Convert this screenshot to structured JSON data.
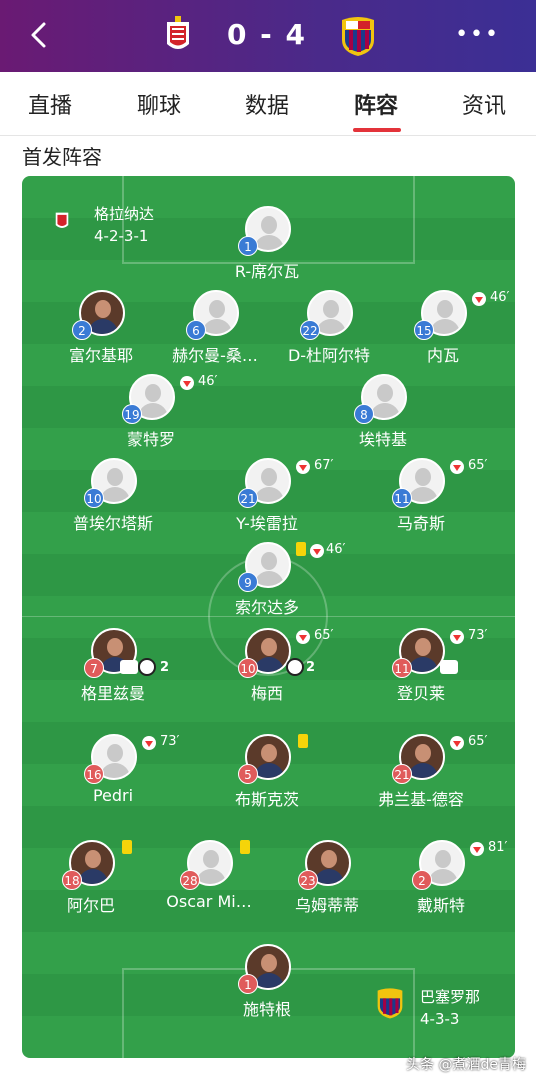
{
  "header": {
    "home_team_icon": "granada-crest-icon",
    "away_team_icon": "barcelona-crest-icon",
    "score": "0 - 4",
    "more_label": "•••"
  },
  "tabs": [
    {
      "label": "直播"
    },
    {
      "label": "聊球"
    },
    {
      "label": "数据"
    },
    {
      "label": "阵容",
      "active": true
    },
    {
      "label": "资讯"
    }
  ],
  "section_title": "首发阵容",
  "home_team": {
    "name": "格拉纳达",
    "formation": "4-2-3-1"
  },
  "away_team": {
    "name": "巴塞罗那",
    "formation": "4-3-3"
  },
  "home_players": [
    {
      "num": "1",
      "name": "R-席尔瓦"
    },
    {
      "num": "2",
      "name": "富尔基耶",
      "photo": true
    },
    {
      "num": "6",
      "name": "赫尔曼-桑…"
    },
    {
      "num": "22",
      "name": "D-杜阿尔特"
    },
    {
      "num": "15",
      "name": "内瓦",
      "sub": "46′"
    },
    {
      "num": "19",
      "name": "蒙特罗",
      "sub": "46′"
    },
    {
      "num": "8",
      "name": "埃特基"
    },
    {
      "num": "10",
      "name": "普埃尔塔斯"
    },
    {
      "num": "21",
      "name": "Y-埃雷拉",
      "sub": "67′"
    },
    {
      "num": "11",
      "name": "马奇斯",
      "sub": "65′"
    },
    {
      "num": "9",
      "name": "索尔达多",
      "sub": "46′",
      "card": true
    }
  ],
  "away_players": [
    {
      "num": "7",
      "name": "格里兹曼",
      "photo": true,
      "goals": "2"
    },
    {
      "num": "10",
      "name": "梅西",
      "photo": true,
      "sub": "65′",
      "goals": "2"
    },
    {
      "num": "11",
      "name": "登贝莱",
      "photo": true,
      "sub": "73′",
      "assist": true
    },
    {
      "num": "16",
      "name": "Pedri",
      "sub": "73′"
    },
    {
      "num": "5",
      "name": "布斯克茨",
      "photo": true,
      "card": true
    },
    {
      "num": "21",
      "name": "弗兰基-德容",
      "photo": true,
      "sub": "65′"
    },
    {
      "num": "18",
      "name": "阿尔巴",
      "photo": true,
      "card": true
    },
    {
      "num": "28",
      "name": "Oscar Mi…",
      "card": true
    },
    {
      "num": "23",
      "name": "乌姆蒂蒂",
      "photo": true
    },
    {
      "num": "2",
      "name": "戴斯特",
      "sub": "81′"
    },
    {
      "num": "1",
      "name": "施特根",
      "photo": true
    }
  ],
  "colors": {
    "header_start": "#6a1a73",
    "header_end": "#3b2f95",
    "pitch": "#33a04a",
    "home_num": "#3a7bd5",
    "away_num": "#e05b5b",
    "tab_accent": "#e3333a"
  },
  "watermark": "头条 @煮酒de青梅"
}
